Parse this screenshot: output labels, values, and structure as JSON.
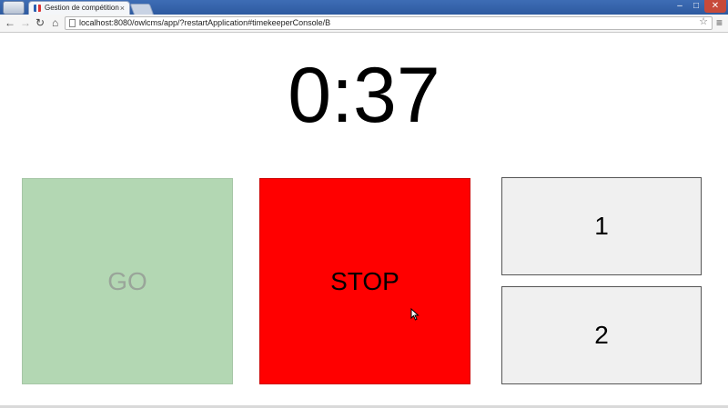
{
  "browser": {
    "tab_title": "Gestion de compétition",
    "tab_close": "×",
    "url": "localhost:8080/owlcms/app/?restartApplication#timekeeperConsole/B",
    "controls": {
      "minimize": "–",
      "maximize": "□",
      "close": "✕"
    },
    "nav": {
      "back": "←",
      "forward": "→",
      "reload": "↻",
      "home": "⌂",
      "star": "☆",
      "menu": "≡"
    }
  },
  "timer": {
    "value": "0:37"
  },
  "buttons": {
    "go": "GO",
    "stop": "STOP",
    "decision_one": "1",
    "decision_two": "2"
  },
  "colors": {
    "go_bg": "#b3d7b3",
    "stop_bg": "#ff0000",
    "decision_bg": "#f0f0f0"
  }
}
